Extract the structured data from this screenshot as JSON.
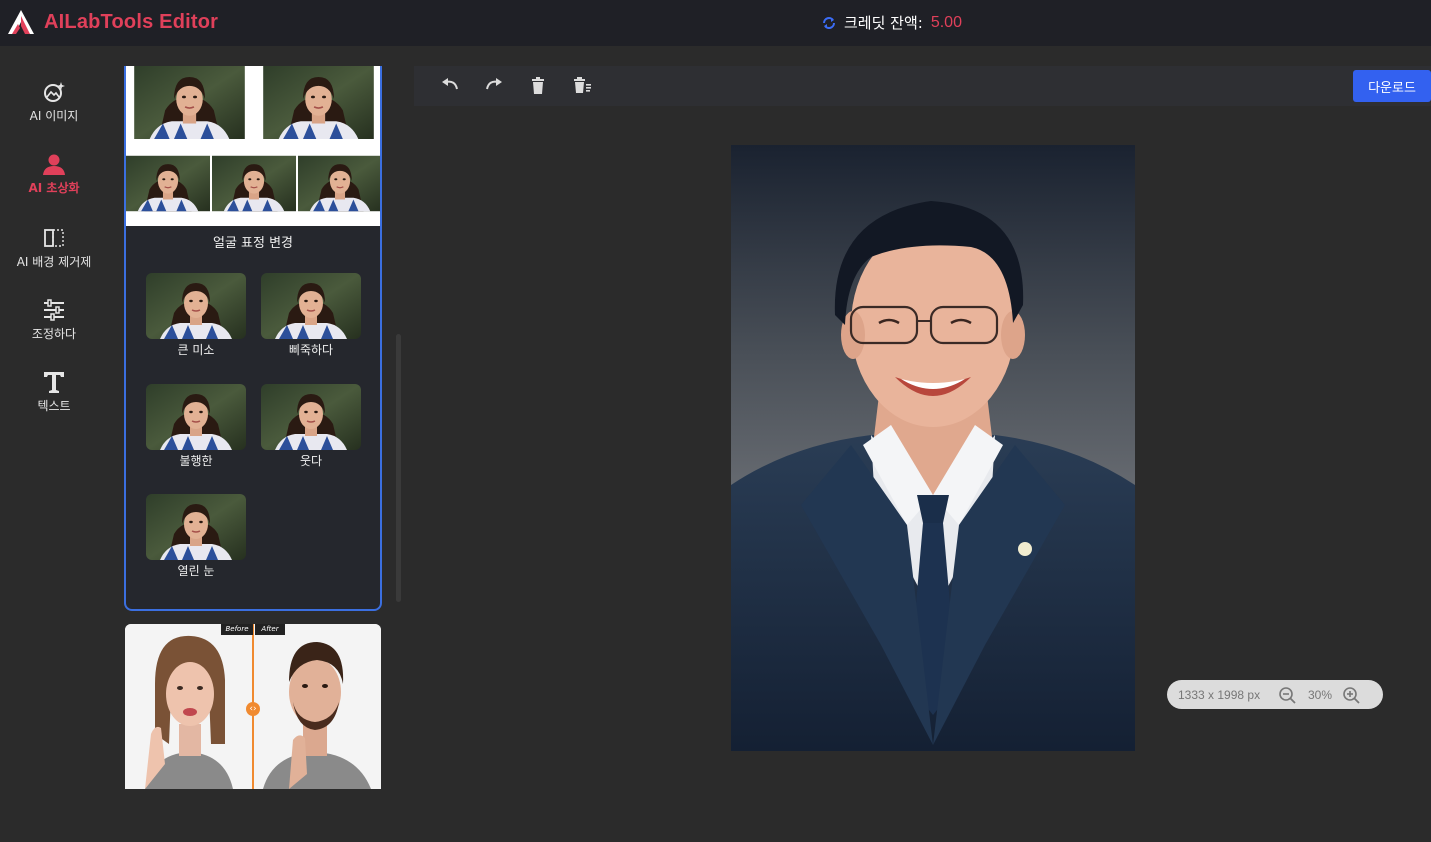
{
  "header": {
    "brand": "AILabTools Editor",
    "credit_label": "크레딧 잔액:",
    "credit_value": "5.00"
  },
  "nav": {
    "items": [
      {
        "label": "AI 이미지",
        "icon": "ai-image-icon"
      },
      {
        "label": "AI 초상화",
        "icon": "portrait-icon",
        "active": true
      },
      {
        "label": "AI 배경 제거제",
        "icon": "background-remove-icon"
      },
      {
        "label": "조정하다",
        "icon": "sliders-icon"
      },
      {
        "label": "텍스트",
        "icon": "text-icon"
      }
    ]
  },
  "panel": {
    "title": "얼굴 표정 변경",
    "options": [
      {
        "label": "큰 미소"
      },
      {
        "label": "삐죽하다"
      },
      {
        "label": "불행한"
      },
      {
        "label": "웃다"
      },
      {
        "label": "열린 눈"
      }
    ]
  },
  "card2": {
    "before_label": "Before",
    "after_label": "After"
  },
  "toolbar": {
    "tools": [
      "undo-icon",
      "redo-icon",
      "delete-icon",
      "clear-all-icon"
    ],
    "download_label": "다운로드"
  },
  "zoom": {
    "dimensions": "1333 x 1998 px",
    "percent": "30%"
  },
  "colors": {
    "accent": "#e0405a",
    "primary": "#3361f0",
    "selection_border": "#3b6fe0",
    "background": "#2b2b2b",
    "topbar": "#1f2026"
  }
}
